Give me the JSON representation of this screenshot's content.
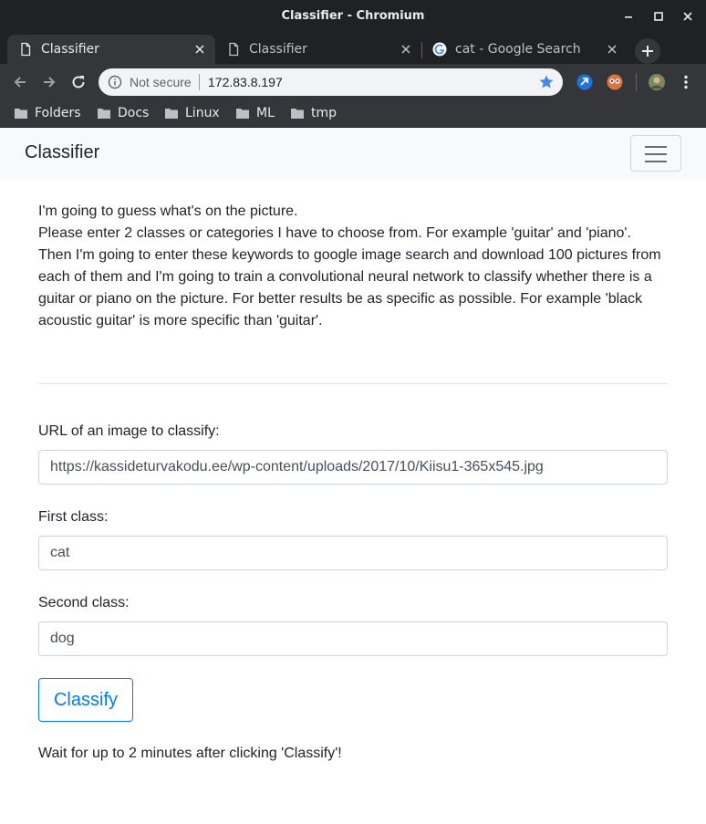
{
  "window": {
    "title": "Classifier - Chromium"
  },
  "tabs": [
    {
      "label": "Classifier",
      "active": true
    },
    {
      "label": "Classifier",
      "active": false
    },
    {
      "label": "cat - Google Search",
      "active": false
    }
  ],
  "toolbar": {
    "security_label": "Not secure",
    "url": "172.83.8.197"
  },
  "bookmarks": [
    {
      "label": "Folders"
    },
    {
      "label": "Docs"
    },
    {
      "label": "Linux"
    },
    {
      "label": "ML"
    },
    {
      "label": "tmp"
    }
  ],
  "navbar": {
    "brand": "Classifier"
  },
  "intro": {
    "lines": [
      "I'm going to guess what's on the picture.",
      "Please enter 2 classes or categories I have to choose from. For example 'guitar' and 'piano'. Then I'm going to enter these keywords to google image search and download 100 pictures from each of them and I'm going to train a convolutional neural network to classify whether there is a guitar or piano on the picture. For better results be as specific as possible. For example 'black acoustic guitar' is more specific than 'guitar'."
    ]
  },
  "form": {
    "url_label": "URL of an image to classify:",
    "url_value": "https://kassideturvakodu.ee/wp-content/uploads/2017/10/Kiisu1-365x545.jpg",
    "first_label": "First class:",
    "first_value": "cat",
    "second_label": "Second class:",
    "second_value": "dog",
    "submit_label": "Classify"
  },
  "note": "Wait for up to 2 minutes after clicking 'Classify'!",
  "colors": {
    "accent": "#007bff",
    "chrome_dark": "#202124",
    "chrome_toolbar": "#35363a"
  }
}
